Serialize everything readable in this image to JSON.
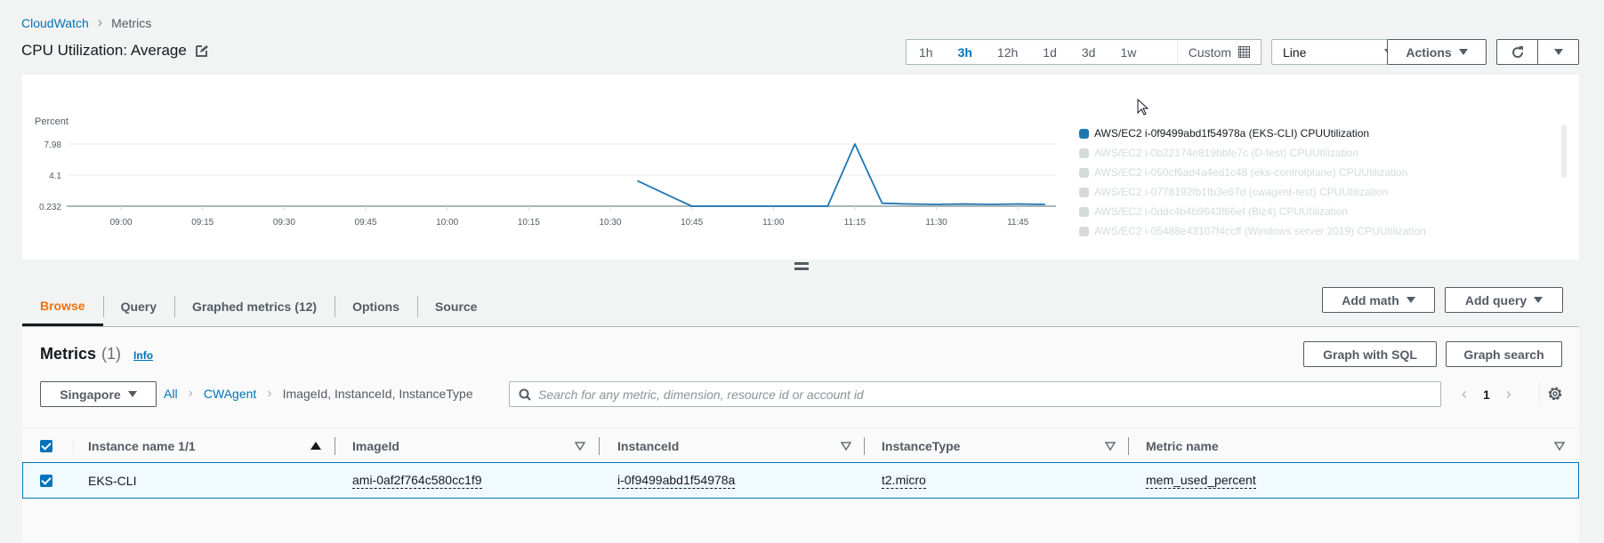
{
  "breadcrumb": {
    "root": "CloudWatch",
    "current": "Metrics"
  },
  "title": "CPU Utilization: Average",
  "time_range": {
    "options": [
      "1h",
      "3h",
      "12h",
      "1d",
      "3d",
      "1w"
    ],
    "selected": "3h",
    "custom_label": "Custom"
  },
  "graph_type": {
    "selected": "Line"
  },
  "actions_label": "Actions",
  "chart_data": {
    "type": "line",
    "title": "",
    "ylabel": "Percent",
    "xlabel": "",
    "y_ticks": [
      "7.98",
      "4.1",
      "0.232"
    ],
    "ylim": [
      0.232,
      7.98
    ],
    "x_ticks": [
      "09:00",
      "09:15",
      "09:30",
      "09:45",
      "10:00",
      "10:15",
      "10:30",
      "10:45",
      "11:00",
      "11:15",
      "11:30",
      "11:45"
    ],
    "x_range_minutes": [
      -10,
      172
    ],
    "grid": true,
    "legend_position": "right",
    "series": [
      {
        "name": "AWS/EC2 i-0f9499abd1f54978a (EKS-CLI) CPUUtilization",
        "color": "#1f77b4",
        "points": [
          {
            "t": "10:35",
            "v": 3.4
          },
          {
            "t": "10:40",
            "v": 1.8
          },
          {
            "t": "10:45",
            "v": 0.232
          },
          {
            "t": "10:50",
            "v": 0.232
          },
          {
            "t": "10:55",
            "v": 0.232
          },
          {
            "t": "11:00",
            "v": 0.232
          },
          {
            "t": "11:05",
            "v": 0.232
          },
          {
            "t": "11:10",
            "v": 0.232
          },
          {
            "t": "11:15",
            "v": 7.98
          },
          {
            "t": "11:20",
            "v": 0.6
          },
          {
            "t": "11:25",
            "v": 0.5
          },
          {
            "t": "11:30",
            "v": 0.45
          },
          {
            "t": "11:35",
            "v": 0.5
          },
          {
            "t": "11:40",
            "v": 0.45
          },
          {
            "t": "11:45",
            "v": 0.5
          },
          {
            "t": "11:50",
            "v": 0.45
          }
        ]
      }
    ],
    "legend": [
      {
        "label": "AWS/EC2 i-0f9499abd1f54978a (EKS-CLI) CPUUtilization",
        "active": true
      },
      {
        "label": "AWS/EC2 i-0b22174e819bbfe7c (D-test) CPUUtilization",
        "active": false
      },
      {
        "label": "AWS/EC2 i-050cf6ad4a4ed1c48 (eks-controlplane) CPUUtilization",
        "active": false
      },
      {
        "label": "AWS/EC2 i-0778192fb1fb3e67d (cwagent-test) CPUUtilization",
        "active": false
      },
      {
        "label": "AWS/EC2 i-0ddc4b4b9643f66ef (Biz4) CPUUtilization",
        "active": false
      },
      {
        "label": "AWS/EC2 i-05488e43107f4ccff (Windows server 2019) CPUUtilization",
        "active": false
      }
    ]
  },
  "tabs": [
    {
      "label": "Browse",
      "active": true
    },
    {
      "label": "Query",
      "active": false
    },
    {
      "label": "Graphed metrics (12)",
      "active": false
    },
    {
      "label": "Options",
      "active": false
    },
    {
      "label": "Source",
      "active": false
    }
  ],
  "tab_actions": {
    "add_math": "Add math",
    "add_query": "Add query"
  },
  "metrics": {
    "heading": "Metrics",
    "count": "(1)",
    "info": "Info",
    "graph_sql": "Graph with SQL",
    "graph_search": "Graph search",
    "region": "Singapore",
    "filter_path": {
      "all": "All",
      "namespace": "CWAgent",
      "dimensions": "ImageId, InstanceId, InstanceType"
    },
    "search_placeholder": "Search for any metric, dimension, resource id or account id",
    "page": "1",
    "columns": [
      "Instance name 1/1",
      "ImageId",
      "InstanceId",
      "InstanceType",
      "Metric name"
    ],
    "rows": [
      {
        "selected": true,
        "instance_name": "EKS-CLI",
        "image_id": "ami-0af2f764c580cc1f9",
        "instance_id": "i-0f9499abd1f54978a",
        "instance_type": "t2.micro",
        "metric_name": "mem_used_percent"
      }
    ]
  }
}
